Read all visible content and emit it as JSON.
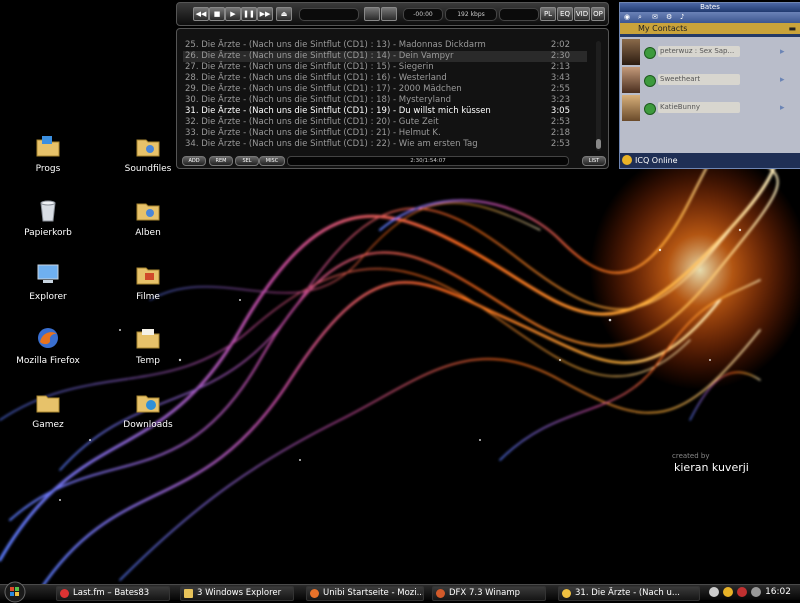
{
  "desktop": {
    "icons": [
      {
        "label": "Progs"
      },
      {
        "label": "Soundfiles"
      },
      {
        "label": "Papierkorb"
      },
      {
        "label": "Alben"
      },
      {
        "label": "Explorer"
      },
      {
        "label": "Filme"
      },
      {
        "label": "Mozilla Firefox"
      },
      {
        "label": "Temp"
      },
      {
        "label": "Gamez"
      },
      {
        "label": "Downloads"
      }
    ],
    "credit": {
      "created_by": "created by",
      "author": "kieran kuverji"
    }
  },
  "winamp": {
    "player": {
      "buttons": [
        "◀◀",
        "■",
        "▶",
        "❚❚",
        "▶▶",
        "⏏"
      ],
      "time": "-00:00",
      "bitrate": "192 kbps",
      "toggles": [
        "PL",
        "EQ",
        "VID",
        "OP"
      ]
    },
    "playlist": {
      "items": [
        {
          "title": "25. Die Ärzte - (Nach uns die Sintflut (CD1) : 13) -  Madonnas Dickdarm",
          "duration": "2:02"
        },
        {
          "title": "26. Die Ärzte - (Nach uns die Sintflut (CD1) : 14) -  Dein Vampyr",
          "duration": "2:30"
        },
        {
          "title": "27. Die Ärzte - (Nach uns die Sintflut (CD1) : 15) -  Siegerin",
          "duration": "2:13"
        },
        {
          "title": "28. Die Ärzte - (Nach uns die Sintflut (CD1) : 16) -  Westerland",
          "duration": "3:43"
        },
        {
          "title": "29. Die Ärzte - (Nach uns die Sintflut (CD1) : 17) -  2000 Mädchen",
          "duration": "2:55"
        },
        {
          "title": "30. Die Ärzte - (Nach uns die Sintflut (CD1) : 18) -  Mysteryland",
          "duration": "3:23"
        },
        {
          "title": "31. Die Ärzte - (Nach uns die Sintflut (CD1) : 19) -  Du willst mich küssen",
          "duration": "3:05"
        },
        {
          "title": "32. Die Ärzte - (Nach uns die Sintflut (CD1) : 20) -  Gute Zeit",
          "duration": "2:53"
        },
        {
          "title": "33. Die Ärzte - (Nach uns die Sintflut (CD1) : 21) -  Helmut K.",
          "duration": "2:18"
        },
        {
          "title": "34. Die Ärzte - (Nach uns die Sintflut (CD1) : 22) -  Wie am ersten Tag",
          "duration": "2:53"
        }
      ],
      "current_index": 6,
      "buttons": [
        "ADD",
        "REM",
        "SEL",
        "MISC",
        "LIST"
      ],
      "total_time": "2:30/1:54:07"
    }
  },
  "icq": {
    "title": "Bates",
    "group": "My Contacts",
    "contacts": [
      {
        "name": "peterwuz : Sex Sap..."
      },
      {
        "name": "Sweetheart"
      },
      {
        "name": "KatieBunny"
      }
    ],
    "status": "ICQ Online"
  },
  "taskbar": {
    "tasks": [
      {
        "label": "Last.fm – Bates83",
        "icon_color": "#d33"
      },
      {
        "label": "3 Windows Explorer",
        "icon_color": "#e8c35a"
      },
      {
        "label": "Unibi Startseite - Mozi...",
        "icon_color": "#e8722a"
      },
      {
        "label": "DFX 7.3 Winamp",
        "icon_color": "#d35a2a"
      },
      {
        "label": "31. Die Ärzte - (Nach u...",
        "icon_color": "#f0c040"
      }
    ],
    "clock": "16:02"
  }
}
